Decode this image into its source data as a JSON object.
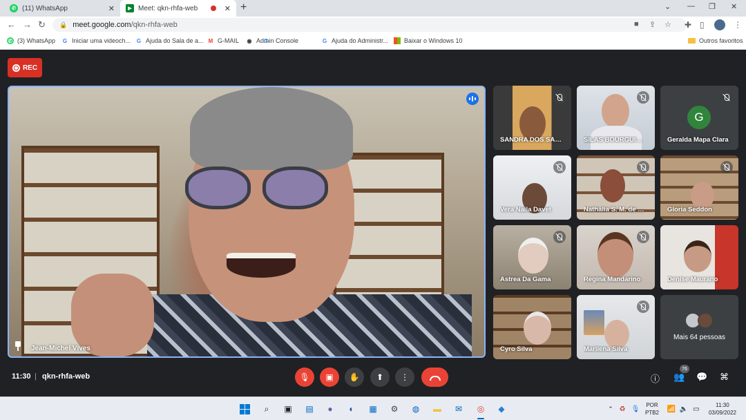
{
  "browser": {
    "tabs": [
      {
        "title": "(11) WhatsApp",
        "favicon": "whatsapp-icon",
        "active": false
      },
      {
        "title": "Meet: qkn-rhfa-web",
        "favicon": "google-meet-icon",
        "active": true,
        "recording": true
      }
    ],
    "url_host": "meet.google.com",
    "url_path": "/qkn-rhfa-web",
    "bookmarks": [
      {
        "label": "(3) WhatsApp",
        "icon": "whatsapp-icon"
      },
      {
        "label": "Iniciar uma videoch...",
        "icon": "google-icon"
      },
      {
        "label": "Ajuda do Sala de a...",
        "icon": "google-icon"
      },
      {
        "label": "G-MAIL",
        "icon": "gmail-icon"
      },
      {
        "label": "Admin Console",
        "icon": "globe-icon"
      },
      {
        "label": "Ajuda do Administr...",
        "icon": "google-icon"
      },
      {
        "label": "Baixar o Windows 10",
        "icon": "windows-icon"
      }
    ],
    "other_bookmarks": "Outros favoritos"
  },
  "meet": {
    "rec_label": "REC",
    "presenter_name": "Jean-Michel Vives",
    "participants": [
      {
        "name": "SANDRA DOS SANTOS",
        "muted": true
      },
      {
        "name": "SILAS BOURGUIGNON",
        "muted": true
      },
      {
        "name": "Geralda Mapa Clara",
        "muted": true,
        "avatar_letter": "G"
      },
      {
        "name": "Vera Naila Davet",
        "muted": true
      },
      {
        "name": "Nathália S. M. de Souza",
        "muted": true
      },
      {
        "name": "Gloria Seddon",
        "muted": true
      },
      {
        "name": "Astrea Da Gama",
        "muted": true
      },
      {
        "name": "Regina Mandarino",
        "muted": true
      },
      {
        "name": "Denise Maurano",
        "muted": false
      },
      {
        "name": "Cyro Silva",
        "muted": false
      },
      {
        "name": "Marilena Silva",
        "muted": true
      }
    ],
    "more_people": "Mais 64 pessoas",
    "time": "11:30",
    "separator": "|",
    "meeting_code": "qkn-rhfa-web",
    "people_count": "76"
  },
  "taskbar": {
    "language_line1": "POR",
    "language_line2": "PTB2",
    "clock_time": "11:30",
    "clock_date": "03/09/2022"
  },
  "colors": {
    "meet_bg": "#202124",
    "accent": "#8ab4f8",
    "danger": "#ea4335",
    "rec": "#d93025"
  }
}
